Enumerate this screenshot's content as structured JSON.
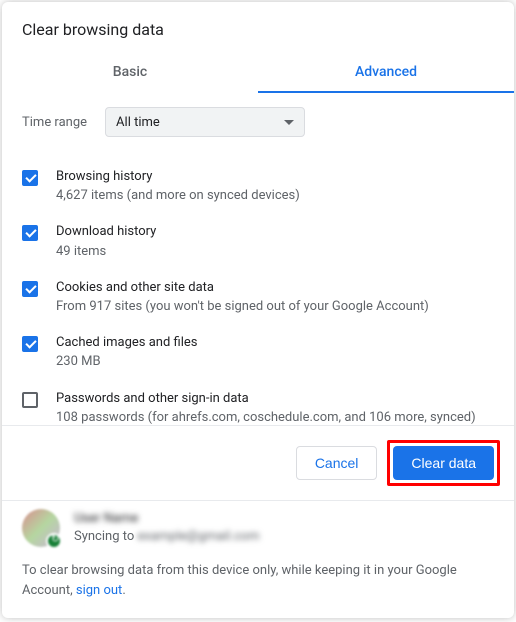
{
  "title": "Clear browsing data",
  "tabs": {
    "basic": "Basic",
    "advanced": "Advanced"
  },
  "timeRange": {
    "label": "Time range",
    "value": "All time"
  },
  "items": [
    {
      "checked": true,
      "title": "Browsing history",
      "sub": "4,627 items (and more on synced devices)"
    },
    {
      "checked": true,
      "title": "Download history",
      "sub": "49 items"
    },
    {
      "checked": true,
      "title": "Cookies and other site data",
      "sub": "From 917 sites (you won't be signed out of your Google Account)"
    },
    {
      "checked": true,
      "title": "Cached images and files",
      "sub": "230 MB"
    },
    {
      "checked": false,
      "title": "Passwords and other sign-in data",
      "sub": "108 passwords (for ahrefs.com, coschedule.com, and 106 more, synced)"
    }
  ],
  "buttons": {
    "cancel": "Cancel",
    "clear": "Clear data"
  },
  "account": {
    "name": "User Name",
    "syncPrefix": "Syncing to ",
    "email": "example@gmail.com"
  },
  "note": {
    "text": "To clear browsing data from this device only, while keeping it in your Google Account, ",
    "link": "sign out",
    "suffix": "."
  }
}
